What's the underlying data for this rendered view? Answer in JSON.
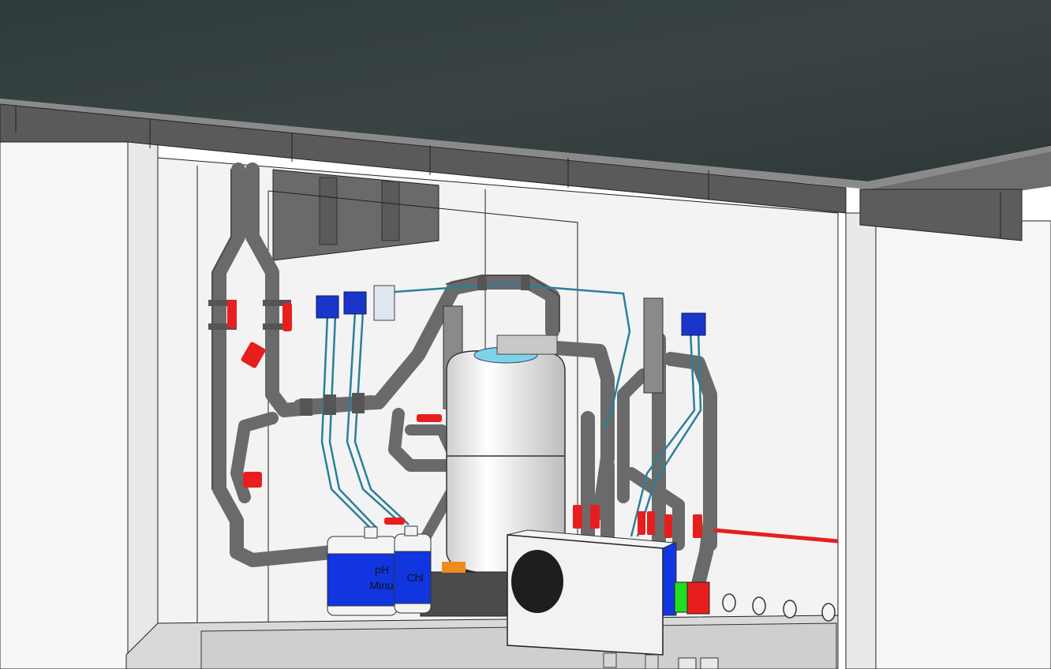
{
  "scene": {
    "colors": {
      "roof": "#34403f",
      "roof_edge": "#4b4f4f",
      "wall": "#ececec",
      "pipe": "#6a6a6a",
      "pipe_dark": "#4e4e4e",
      "valve": "#e81e1e",
      "sensor": "#1a35c9",
      "dosing_line": "#2a7f9a",
      "tank": "#f4f4f4",
      "tank_top": "#7fd3e8",
      "canister": "#1136e0",
      "heat_pump": "#f2f2f2",
      "fan": "#1e1e1e",
      "heater_cable": "#e81e1e",
      "indicator_green": "#22dd22",
      "indicator_red": "#e81e1e"
    },
    "canisters": [
      {
        "label_line1": "pH",
        "label_line2": "Minus"
      },
      {
        "label_line1": "Chl",
        "label_line2": ""
      }
    ]
  }
}
